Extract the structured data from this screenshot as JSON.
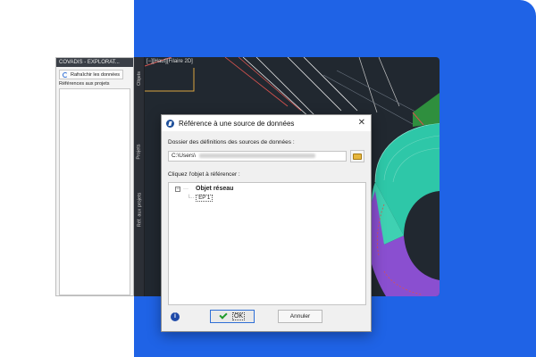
{
  "colors": {
    "accent_blue": "#1f63e6",
    "cad_background": "#212830",
    "teal_surface": "#2ec7a8",
    "purple_band": "#8a4fd0"
  },
  "explorer": {
    "title": "COVADIS - EXPLORAT...",
    "refresh_label": "Rafraîchir les données",
    "refs_label": "Références aux projets"
  },
  "tabs": [
    "Objets",
    "Projets",
    "Réf. aux projets"
  ],
  "viewport": {
    "label": "[−][Haut][Filaire 2D]"
  },
  "dialog": {
    "title": "Référence à une source de données",
    "folder_label": "Dossier des définitions des sources de données :",
    "path_value": "C:\\Users\\",
    "click_label": "Cliquez l'objet à référencer :",
    "tree": {
      "expander": "−",
      "root_label": "Objet réseau",
      "child_label": "EP 1"
    },
    "ok_label": "OK",
    "cancel_label": "Annuler"
  },
  "icons": [
    "refresh-icon",
    "app-icon",
    "close-icon",
    "folder-icon",
    "info-icon",
    "check-icon"
  ]
}
